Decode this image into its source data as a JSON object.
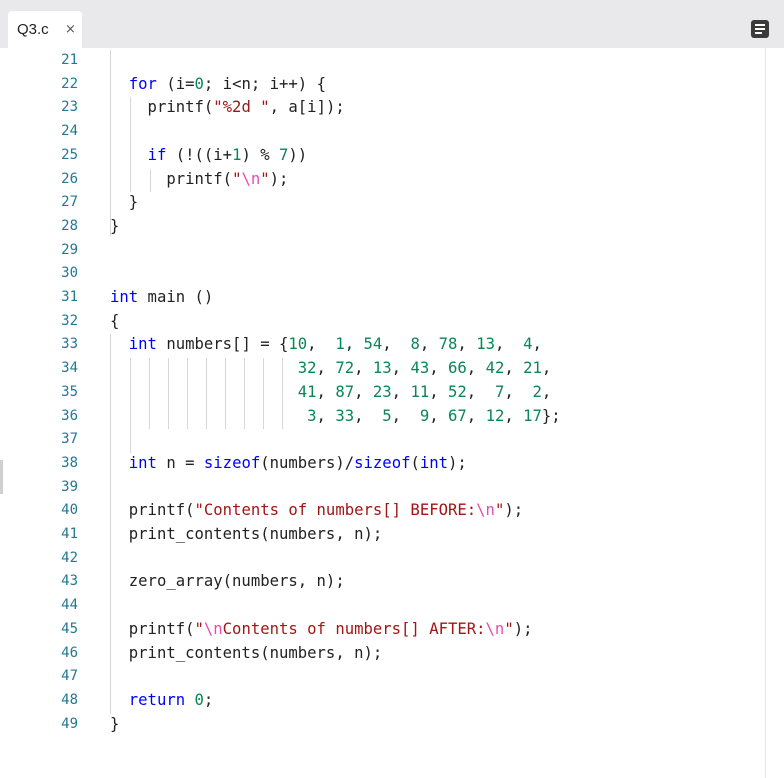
{
  "tab": {
    "filename": "Q3.c",
    "close_glyph": "×"
  },
  "menu_icon": "menu-icon",
  "lines": [
    {
      "n": "21",
      "segs": []
    },
    {
      "n": "22",
      "segs": [
        {
          "t": "  "
        },
        {
          "t": "for",
          "c": "kw"
        },
        {
          "t": " (i="
        },
        {
          "t": "0",
          "c": "num"
        },
        {
          "t": "; i<n; i++) {"
        }
      ]
    },
    {
      "n": "23",
      "segs": [
        {
          "t": "    printf("
        },
        {
          "t": "\"%2d \"",
          "c": "str"
        },
        {
          "t": ", a[i]);"
        }
      ]
    },
    {
      "n": "24",
      "segs": []
    },
    {
      "n": "25",
      "segs": [
        {
          "t": "    "
        },
        {
          "t": "if",
          "c": "kw"
        },
        {
          "t": " (!((i+"
        },
        {
          "t": "1",
          "c": "num"
        },
        {
          "t": ") % "
        },
        {
          "t": "7",
          "c": "num"
        },
        {
          "t": "))"
        }
      ]
    },
    {
      "n": "26",
      "segs": [
        {
          "t": "      printf("
        },
        {
          "t": "\"",
          "c": "str"
        },
        {
          "t": "\\n",
          "c": "escp"
        },
        {
          "t": "\"",
          "c": "str"
        },
        {
          "t": ");"
        }
      ]
    },
    {
      "n": "27",
      "segs": [
        {
          "t": "  }"
        }
      ]
    },
    {
      "n": "28",
      "segs": [
        {
          "t": "}"
        }
      ]
    },
    {
      "n": "29",
      "segs": []
    },
    {
      "n": "30",
      "segs": []
    },
    {
      "n": "31",
      "segs": [
        {
          "t": "int",
          "c": "kw"
        },
        {
          "t": " main ()"
        }
      ]
    },
    {
      "n": "32",
      "segs": [
        {
          "t": "{"
        }
      ]
    },
    {
      "n": "33",
      "segs": [
        {
          "t": "  "
        },
        {
          "t": "int",
          "c": "kw"
        },
        {
          "t": " numbers[] = {"
        },
        {
          "t": "10",
          "c": "num"
        },
        {
          "t": ",  "
        },
        {
          "t": "1",
          "c": "num"
        },
        {
          "t": ", "
        },
        {
          "t": "54",
          "c": "num"
        },
        {
          "t": ",  "
        },
        {
          "t": "8",
          "c": "num"
        },
        {
          "t": ", "
        },
        {
          "t": "78",
          "c": "num"
        },
        {
          "t": ", "
        },
        {
          "t": "13",
          "c": "num"
        },
        {
          "t": ",  "
        },
        {
          "t": "4",
          "c": "num"
        },
        {
          "t": ","
        }
      ]
    },
    {
      "n": "34",
      "segs": [
        {
          "t": "                    "
        },
        {
          "t": "32",
          "c": "num"
        },
        {
          "t": ", "
        },
        {
          "t": "72",
          "c": "num"
        },
        {
          "t": ", "
        },
        {
          "t": "13",
          "c": "num"
        },
        {
          "t": ", "
        },
        {
          "t": "43",
          "c": "num"
        },
        {
          "t": ", "
        },
        {
          "t": "66",
          "c": "num"
        },
        {
          "t": ", "
        },
        {
          "t": "42",
          "c": "num"
        },
        {
          "t": ", "
        },
        {
          "t": "21",
          "c": "num"
        },
        {
          "t": ","
        }
      ]
    },
    {
      "n": "35",
      "segs": [
        {
          "t": "                    "
        },
        {
          "t": "41",
          "c": "num"
        },
        {
          "t": ", "
        },
        {
          "t": "87",
          "c": "num"
        },
        {
          "t": ", "
        },
        {
          "t": "23",
          "c": "num"
        },
        {
          "t": ", "
        },
        {
          "t": "11",
          "c": "num"
        },
        {
          "t": ", "
        },
        {
          "t": "52",
          "c": "num"
        },
        {
          "t": ",  "
        },
        {
          "t": "7",
          "c": "num"
        },
        {
          "t": ",  "
        },
        {
          "t": "2",
          "c": "num"
        },
        {
          "t": ","
        }
      ]
    },
    {
      "n": "36",
      "segs": [
        {
          "t": "                     "
        },
        {
          "t": "3",
          "c": "num"
        },
        {
          "t": ", "
        },
        {
          "t": "33",
          "c": "num"
        },
        {
          "t": ",  "
        },
        {
          "t": "5",
          "c": "num"
        },
        {
          "t": ",  "
        },
        {
          "t": "9",
          "c": "num"
        },
        {
          "t": ", "
        },
        {
          "t": "67",
          "c": "num"
        },
        {
          "t": ", "
        },
        {
          "t": "12",
          "c": "num"
        },
        {
          "t": ", "
        },
        {
          "t": "17",
          "c": "num"
        },
        {
          "t": "};"
        }
      ]
    },
    {
      "n": "37",
      "segs": []
    },
    {
      "n": "38",
      "segs": [
        {
          "t": "  "
        },
        {
          "t": "int",
          "c": "kw"
        },
        {
          "t": " n = "
        },
        {
          "t": "sizeof",
          "c": "kw"
        },
        {
          "t": "(numbers)/"
        },
        {
          "t": "sizeof",
          "c": "kw"
        },
        {
          "t": "("
        },
        {
          "t": "int",
          "c": "kw"
        },
        {
          "t": ");"
        }
      ]
    },
    {
      "n": "39",
      "segs": []
    },
    {
      "n": "40",
      "segs": [
        {
          "t": "  printf("
        },
        {
          "t": "\"Contents of numbers[] BEFORE:",
          "c": "str"
        },
        {
          "t": "\\n",
          "c": "escp"
        },
        {
          "t": "\"",
          "c": "str"
        },
        {
          "t": ");"
        }
      ]
    },
    {
      "n": "41",
      "segs": [
        {
          "t": "  print_contents(numbers, n);"
        }
      ]
    },
    {
      "n": "42",
      "segs": []
    },
    {
      "n": "43",
      "segs": [
        {
          "t": "  zero_array(numbers, n);"
        }
      ]
    },
    {
      "n": "44",
      "segs": []
    },
    {
      "n": "45",
      "segs": [
        {
          "t": "  printf("
        },
        {
          "t": "\"",
          "c": "str"
        },
        {
          "t": "\\n",
          "c": "escp"
        },
        {
          "t": "Contents of numbers[] AFTER:",
          "c": "str"
        },
        {
          "t": "\\n",
          "c": "escp"
        },
        {
          "t": "\"",
          "c": "str"
        },
        {
          "t": ");"
        }
      ]
    },
    {
      "n": "46",
      "segs": [
        {
          "t": "  print_contents(numbers, n);"
        }
      ]
    },
    {
      "n": "47",
      "segs": []
    },
    {
      "n": "48",
      "segs": [
        {
          "t": "  "
        },
        {
          "t": "return",
          "c": "kw"
        },
        {
          "t": " "
        },
        {
          "t": "0",
          "c": "num"
        },
        {
          "t": ";"
        }
      ]
    },
    {
      "n": "49",
      "segs": [
        {
          "t": "}"
        }
      ]
    }
  ]
}
